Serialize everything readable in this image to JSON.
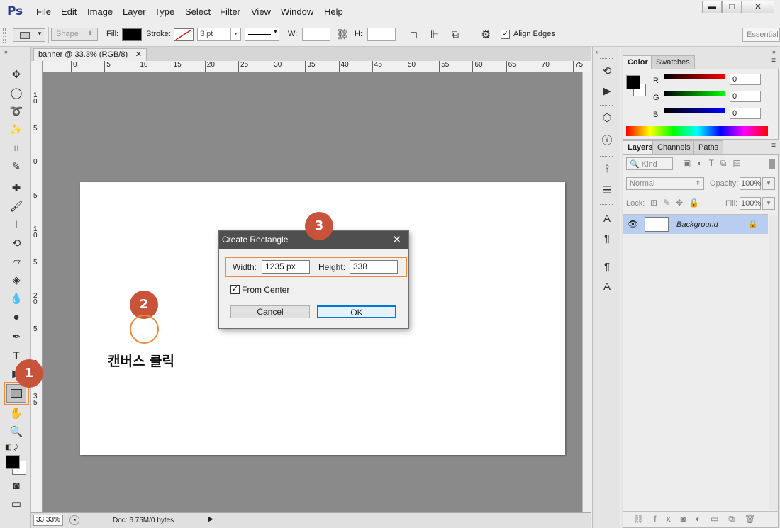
{
  "app": {
    "logo": "Ps",
    "menus": [
      "File",
      "Edit",
      "Image",
      "Layer",
      "Type",
      "Select",
      "Filter",
      "View",
      "Window",
      "Help"
    ]
  },
  "options": {
    "shape_mode": "Shape",
    "fill_label": "Fill:",
    "stroke_label": "Stroke:",
    "stroke_size": "3 pt",
    "w_label": "W:",
    "h_label": "H:",
    "align_edges": "Align Edges",
    "workspace": "Essentials"
  },
  "document": {
    "tab_title": "banner @ 33.3% (RGB/8)",
    "zoom": "33.33%",
    "doc_info": "Doc: 6.75M/0 bytes",
    "hruler_ticks": [
      "0",
      "5",
      "10",
      "15",
      "20",
      "25",
      "30",
      "35",
      "40",
      "45",
      "50",
      "55",
      "60",
      "65",
      "70",
      "75"
    ],
    "vruler_ticks": [
      "1\n0",
      "5",
      "0",
      "5",
      "1\n0",
      "5",
      "2\n0",
      "5",
      "3\n0",
      "3\n5"
    ]
  },
  "color_panel": {
    "tabs": [
      "Color",
      "Swatches"
    ],
    "r_label": "R",
    "g_label": "G",
    "b_label": "B",
    "r": "0",
    "g": "0",
    "b": "0"
  },
  "layers_panel": {
    "tabs": [
      "Layers",
      "Channels",
      "Paths"
    ],
    "kind": "Kind",
    "blend": "Normal",
    "opacity_label": "Opacity:",
    "opacity": "100%",
    "lock_label": "Lock:",
    "fill_label": "Fill:",
    "fill": "100%",
    "layer_name": "Background"
  },
  "dialog": {
    "title": "Create Rectangle",
    "width_label": "Width:",
    "width_value": "1235 px",
    "height_label": "Height:",
    "height_value": "338",
    "from_center": "From Center",
    "cancel": "Cancel",
    "ok": "OK"
  },
  "callouts": {
    "c1": "1",
    "c2": "2",
    "c3": "3",
    "canvas_click": "캔버스 클릭"
  },
  "colors": {
    "accent": "#c9523a",
    "highlight": "#f08a3a",
    "selection": "#b8cdf0"
  }
}
